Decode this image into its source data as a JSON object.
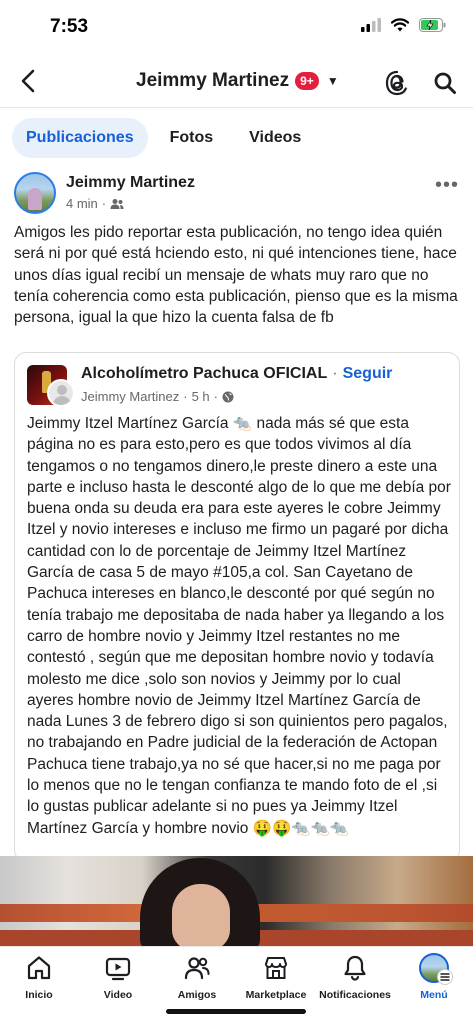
{
  "status_bar": {
    "time": "7:53"
  },
  "header": {
    "title": "Jeimmy Martinez",
    "badge": "9+"
  },
  "tabs": [
    {
      "label": "Publicaciones",
      "active": true
    },
    {
      "label": "Fotos",
      "active": false
    },
    {
      "label": "Videos",
      "active": false
    }
  ],
  "post": {
    "author": "Jeimmy Martinez",
    "time": "4 min",
    "privacy_icon": "friends-icon",
    "text": "Amigos les pido reportar esta publicación, no tengo idea quién será ni por qué está hciendo esto, ni qué intenciones tiene, hace unos días igual recibí un mensaje de whats muy raro que no tenía coherencia como esta publicación, pienso que es la misma persona, igual la que hizo la cuenta falsa de fb"
  },
  "shared_post": {
    "page_name": "Alcoholímetro Pachuca OFICIAL",
    "follow_label": "Seguir",
    "author": "Jeimmy Martinez",
    "time": "5 h",
    "privacy_icon": "globe-icon",
    "text": "Jeimmy Itzel Martínez García 🐀 nada más sé que esta página no es para esto,pero es que todos vivimos al día tengamos o no tengamos dinero,le preste dinero a este una parte e incluso hasta le desconté algo de lo que me debía por buena onda su deuda era para este ayeres le cobre Jeimmy Itzel y novio intereses e incluso me firmo un pagaré por dicha cantidad con lo de porcentaje de Jeimmy Itzel Martínez García de casa 5 de mayo #105,a col. San Cayetano de Pachuca intereses en blanco,le desconté por qué según no tenía trabajo me depositaba de nada haber ya llegando a los carro de hombre novio y Jeimmy Itzel restantes no me contestó , según que me depositan hombre novio y todavía molesto me dice ,solo son novios y Jeimmy por lo cual ayeres hombre novio de Jeimmy Itzel Martínez García de nada Lunes 3 de febrero digo si son quinientos pero pagalos, no trabajando en Padre judicial de la federación de Actopan Pachuca tiene trabajo,ya no sé que hacer,si no me paga por lo menos que no le tengan confianza te mando foto de el ,si lo gustas publicar adelante si no pues ya Jeimmy Itzel Martínez García y hombre novio 🤑🤑🐀🐀🐀"
  },
  "bottom_nav": [
    {
      "label": "Inicio",
      "icon": "home-icon",
      "active": false
    },
    {
      "label": "Video",
      "icon": "video-icon",
      "active": false
    },
    {
      "label": "Amigos",
      "icon": "friends-icon",
      "active": false
    },
    {
      "label": "Marketplace",
      "icon": "marketplace-icon",
      "active": false
    },
    {
      "label": "Notificaciones",
      "icon": "bell-icon",
      "active": false
    },
    {
      "label": "Menú",
      "icon": "profile-menu-icon",
      "active": true
    }
  ],
  "colors": {
    "accent": "#1660d8",
    "badge": "#e41e3f",
    "tab_active_bg": "#e7f0fb"
  }
}
